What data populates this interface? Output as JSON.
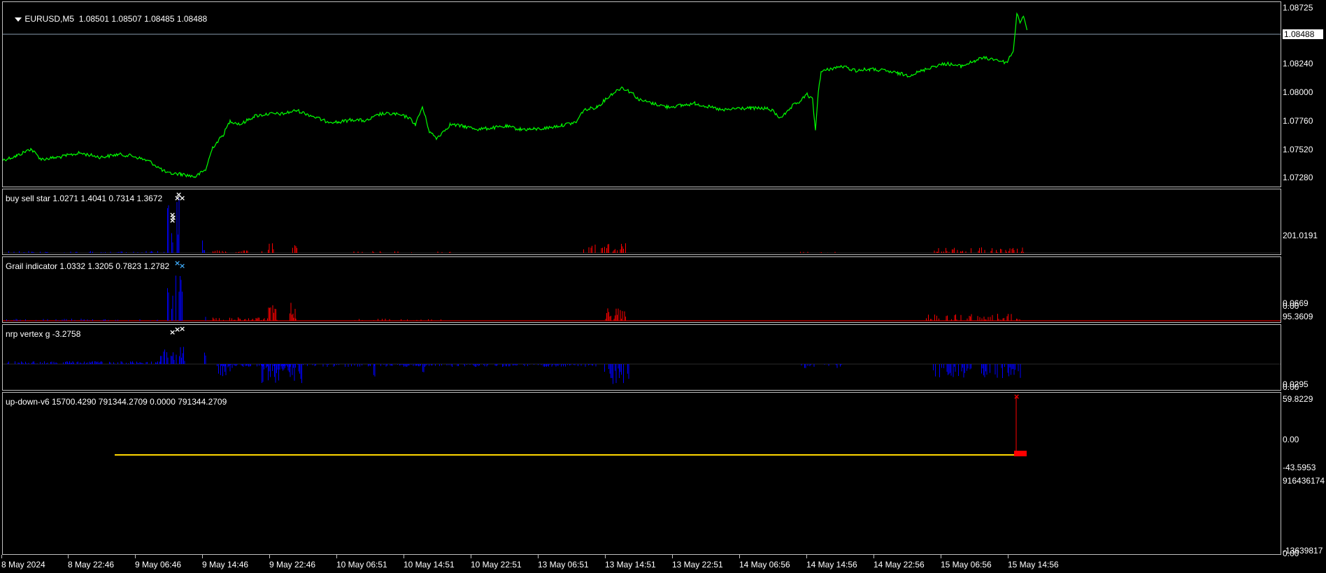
{
  "main_chart": {
    "symbol_label": "EURUSD,M5",
    "ohlc": "1.08501 1.08507 1.08485 1.08488",
    "price_scale": [
      "1.08725",
      "1.08488",
      "1.08240",
      "1.08000",
      "1.07760",
      "1.07520",
      "1.07280"
    ],
    "current_price": "1.08488",
    "line_color": "#00ff00"
  },
  "indicators": [
    {
      "label": "buy sell star 1.0271 1.4041 0.7314 1.3672",
      "scale_top": "201.0191",
      "scale_bottom": "0.0669",
      "scale_zero": "0.00"
    },
    {
      "label": "Grail indicator 1.0332 1.3205 0.7823 1.2782",
      "scale_top": "95.3609",
      "scale_bottom": "0.0295",
      "scale_zero": "0.00"
    },
    {
      "label": "nrp vertex g -3.2758",
      "scale_top": "59.8229",
      "scale_mid": "0.00",
      "scale_bottom": "-43.5953"
    },
    {
      "label": "up-down-v6 15700.4290 791344.2709 0.0000 791344.2709",
      "scale_top": "916436174",
      "scale_bottom": "-13639817",
      "scale_zero": "0.00"
    }
  ],
  "time_axis": [
    "8 May 2024",
    "8 May 22:46",
    "9 May 06:46",
    "9 May 14:46",
    "9 May 22:46",
    "10 May 06:51",
    "10 May 14:51",
    "10 May 22:51",
    "13 May 06:51",
    "13 May 14:51",
    "13 May 22:51",
    "14 May 06:56",
    "14 May 14:56",
    "14 May 22:56",
    "15 May 06:56",
    "15 May 14:56"
  ],
  "colors": {
    "bull": "#0000ff",
    "bear": "#ff0000",
    "price": "#00ff00",
    "yellow_line": "#ffd700"
  }
}
